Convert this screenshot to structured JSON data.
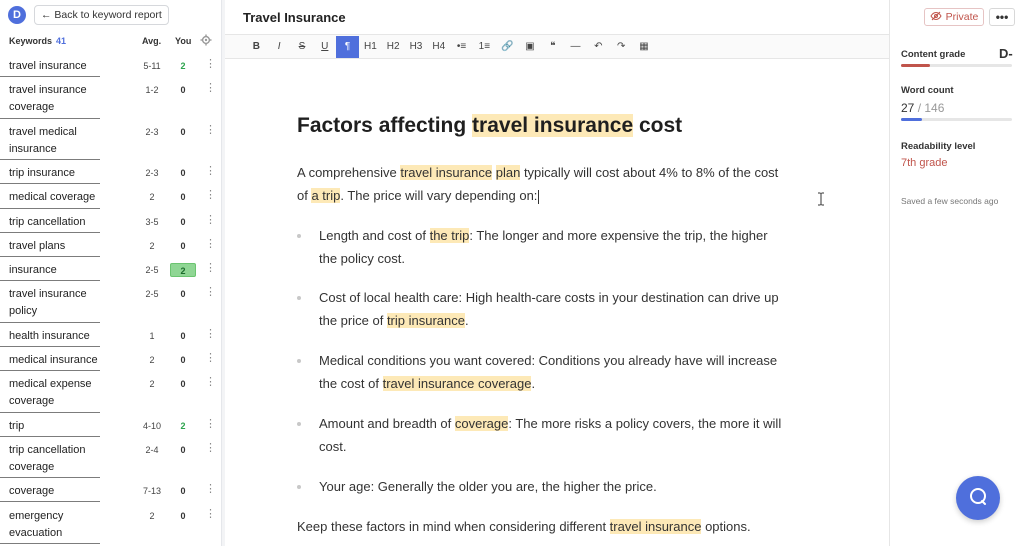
{
  "sidebar": {
    "back_label": "← Back to keyword report",
    "logo": "D",
    "headers": {
      "keywords": "Keywords",
      "count": "41",
      "avg": "Avg.",
      "you": "You"
    },
    "keywords": [
      {
        "text": [
          "travel insurance"
        ],
        "avg": "5-11",
        "you": "2",
        "you_style": "green"
      },
      {
        "text": [
          "travel insurance",
          "coverage"
        ],
        "avg": "1-2",
        "you": "0",
        "you_style": ""
      },
      {
        "text": [
          "travel medical",
          "insurance"
        ],
        "avg": "2-3",
        "you": "0",
        "you_style": ""
      },
      {
        "text": [
          "trip insurance"
        ],
        "avg": "2-3",
        "you": "0",
        "you_style": ""
      },
      {
        "text": [
          "medical coverage"
        ],
        "avg": "2",
        "you": "0",
        "you_style": ""
      },
      {
        "text": [
          "trip cancellation"
        ],
        "avg": "3-5",
        "you": "0",
        "you_style": ""
      },
      {
        "text": [
          "travel plans"
        ],
        "avg": "2",
        "you": "0",
        "you_style": ""
      },
      {
        "text": [
          "insurance"
        ],
        "avg": "2-5",
        "you": "2",
        "you_style": "filled"
      },
      {
        "text": [
          "travel insurance",
          "policy"
        ],
        "avg": "2-5",
        "you": "0",
        "you_style": ""
      },
      {
        "text": [
          "health insurance"
        ],
        "avg": "1",
        "you": "0",
        "you_style": ""
      },
      {
        "text": [
          "medical insurance"
        ],
        "avg": "2",
        "you": "0",
        "you_style": ""
      },
      {
        "text": [
          "medical expense",
          "coverage"
        ],
        "avg": "2",
        "you": "0",
        "you_style": ""
      },
      {
        "text": [
          "trip"
        ],
        "avg": "4-10",
        "you": "2",
        "you_style": "green"
      },
      {
        "text": [
          "trip cancellation",
          "coverage"
        ],
        "avg": "2-4",
        "you": "0",
        "you_style": ""
      },
      {
        "text": [
          "coverage"
        ],
        "avg": "7-13",
        "you": "0",
        "you_style": ""
      },
      {
        "text": [
          "emergency",
          "evacuation"
        ],
        "avg": "2",
        "you": "0",
        "you_style": ""
      }
    ]
  },
  "editor": {
    "doc_title": "Travel Insurance",
    "toolbar": [
      "B",
      "I",
      "S",
      "U",
      "¶",
      "H1",
      "H2",
      "H3",
      "H4",
      "•≡",
      "1≡",
      "🔗",
      "▣",
      "❝",
      "—",
      "↶",
      "↷",
      "▦"
    ],
    "toolbar_names": [
      "bold-button",
      "italic-button",
      "strike-button",
      "underline-button",
      "paragraph-button",
      "h1-button",
      "h2-button",
      "h3-button",
      "h4-button",
      "bullet-list-button",
      "numbered-list-button",
      "link-button",
      "image-button",
      "quote-button",
      "divider-button",
      "undo-button",
      "redo-button",
      "table-button"
    ],
    "heading": {
      "pre": "Factors affecting ",
      "hl": "travel insurance",
      "post": " cost"
    },
    "intro": {
      "a": "A comprehensive ",
      "hl1": "travel insurance",
      "b": " ",
      "hl2": "plan",
      "c": " typically will cost about 4% to 8% of the cost",
      "d": "of ",
      "hl3": "a trip",
      "e": ". The price will vary depending on:"
    },
    "bullets": [
      {
        "a": "Length and cost of ",
        "hl": "the trip",
        "b": ": The longer and more expensive the trip, the higher",
        "c": "the policy cost."
      },
      {
        "a": "Cost of local health care: High health-care costs in your destination can drive up",
        "c1": "the price of ",
        "hl": "trip insurance",
        "c2": "."
      },
      {
        "a": "Medical conditions you want covered: Conditions you already have will increase",
        "c1": "the cost of ",
        "hl": "travel insurance coverage",
        "c2": "."
      },
      {
        "a": "Amount and breadth of ",
        "hl": "coverage",
        "b": ": The more risks a policy covers, the more it will",
        "c": "cost."
      },
      {
        "a": "Your age: Generally the older you are, the higher the price."
      }
    ],
    "closing": {
      "a": "Keep these factors in mind when considering different ",
      "hl": "travel insurance",
      "b": " options."
    }
  },
  "right_panel": {
    "private_label": "Private",
    "more_label": "•••",
    "content_grade_label": "Content grade",
    "content_grade": "D-",
    "content_grade_color": "#c0544b",
    "word_count_label": "Word count",
    "word_count": "27",
    "word_total": "/ 146",
    "word_progress": 0.185,
    "readability_label": "Readability level",
    "readability": "7th grade",
    "saved_text": "Saved a few seconds ago",
    "accent": "#4f6fdc"
  }
}
